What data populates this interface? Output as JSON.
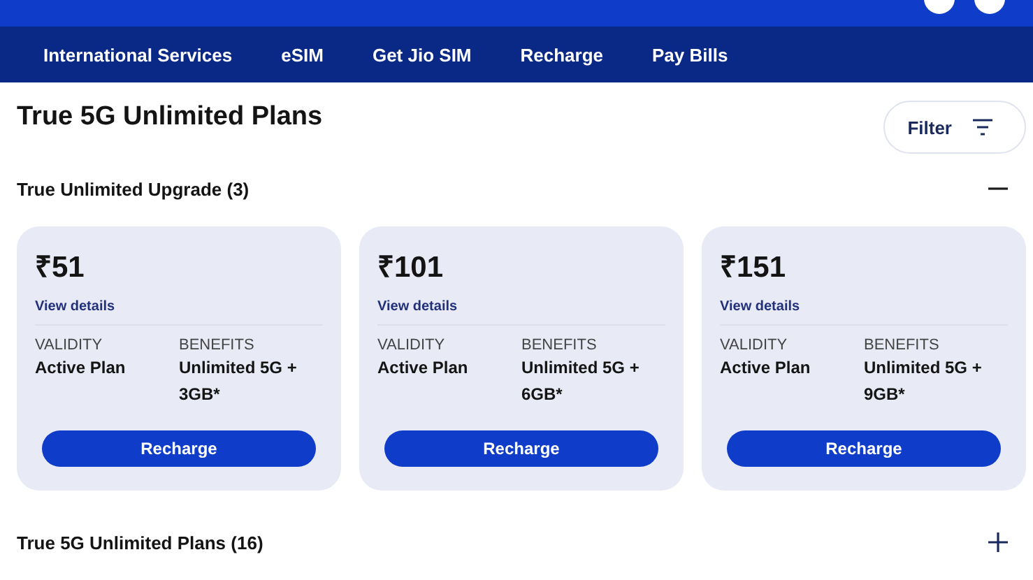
{
  "nav": {
    "items": [
      {
        "label": "International Services"
      },
      {
        "label": "eSIM"
      },
      {
        "label": "Get Jio SIM"
      },
      {
        "label": "Recharge"
      },
      {
        "label": "Pay Bills"
      }
    ]
  },
  "page": {
    "title": "True 5G Unlimited Plans",
    "filter": "Filter"
  },
  "sections": [
    {
      "title": "True Unlimited Upgrade (3)",
      "expanded": true,
      "plans": [
        {
          "price": "₹51",
          "details": "View details",
          "validity_label": "VALIDITY",
          "validity": "Active Plan",
          "benefits_label": "BENEFITS",
          "benefits": "Unlimited 5G + 3GB*",
          "button": "Recharge"
        },
        {
          "price": "₹101",
          "details": "View details",
          "validity_label": "VALIDITY",
          "validity": "Active Plan",
          "benefits_label": "BENEFITS",
          "benefits": "Unlimited 5G + 6GB*",
          "button": "Recharge"
        },
        {
          "price": "₹151",
          "details": "View details",
          "validity_label": "VALIDITY",
          "validity": "Active Plan",
          "benefits_label": "BENEFITS",
          "benefits": "Unlimited 5G + 9GB*",
          "button": "Recharge"
        }
      ]
    },
    {
      "title": "True 5G Unlimited Plans (16)",
      "expanded": false
    }
  ]
}
